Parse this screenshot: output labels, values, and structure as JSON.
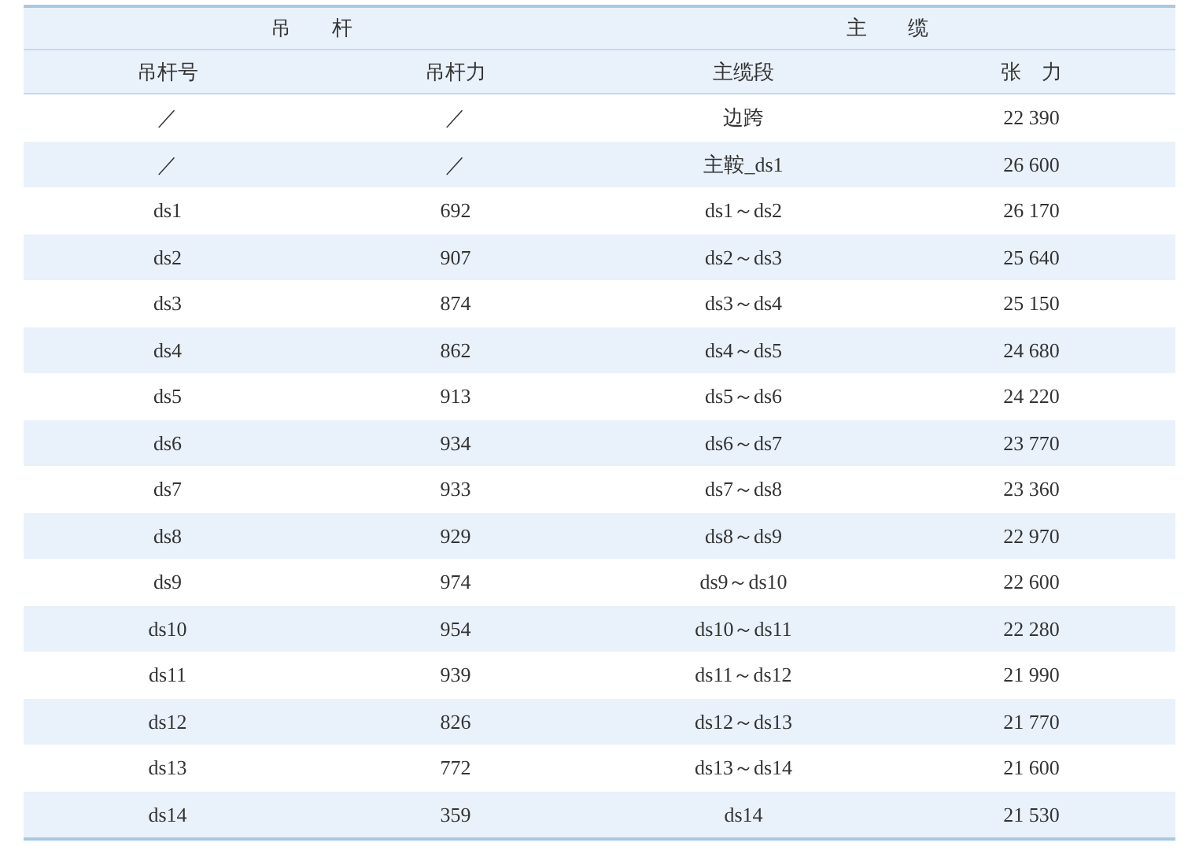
{
  "table": {
    "groups": [
      "吊　　杆",
      "主　　缆"
    ],
    "columns": [
      "吊杆号",
      "吊杆力",
      "主缆段",
      "张　力"
    ],
    "rows": [
      [
        "／",
        "／",
        "边跨",
        "22 390"
      ],
      [
        "／",
        "／",
        "主鞍_ds1",
        "26 600"
      ],
      [
        "ds1",
        "692",
        "ds1～ds2",
        "26 170"
      ],
      [
        "ds2",
        "907",
        "ds2～ds3",
        "25 640"
      ],
      [
        "ds3",
        "874",
        "ds3～ds4",
        "25 150"
      ],
      [
        "ds4",
        "862",
        "ds4～ds5",
        "24 680"
      ],
      [
        "ds5",
        "913",
        "ds5～ds6",
        "24 220"
      ],
      [
        "ds6",
        "934",
        "ds6～ds7",
        "23 770"
      ],
      [
        "ds7",
        "933",
        "ds7～ds8",
        "23 360"
      ],
      [
        "ds8",
        "929",
        "ds8～ds9",
        "22 970"
      ],
      [
        "ds9",
        "974",
        "ds9～ds10",
        "22 600"
      ],
      [
        "ds10",
        "954",
        "ds10～ds11",
        "22 280"
      ],
      [
        "ds11",
        "939",
        "ds11～ds12",
        "21 990"
      ],
      [
        "ds12",
        "826",
        "ds12～ds13",
        "21 770"
      ],
      [
        "ds13",
        "772",
        "ds13～ds14",
        "21 600"
      ],
      [
        "ds14",
        "359",
        "ds14",
        "21 530"
      ]
    ]
  }
}
